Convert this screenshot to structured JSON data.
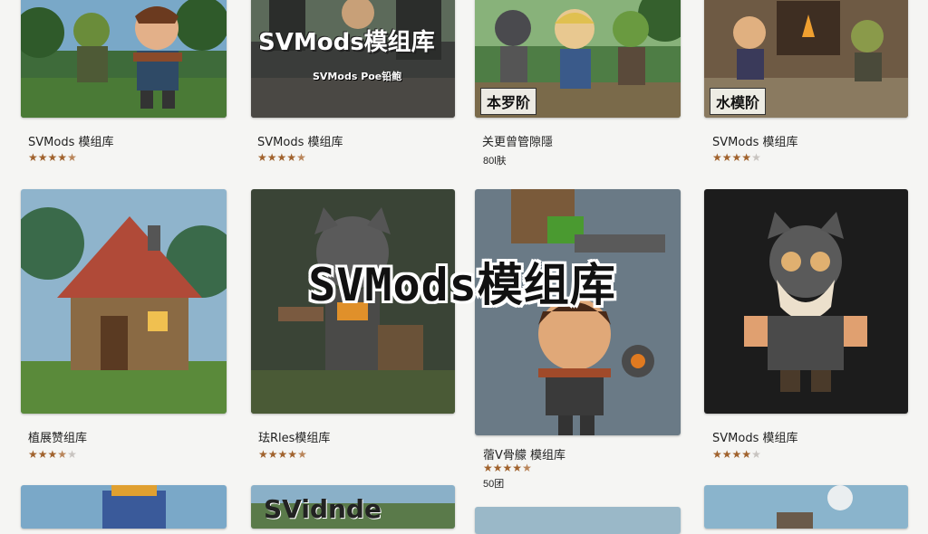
{
  "watermark": "SVMods模组库",
  "colors": {
    "background": "#f5f5f3",
    "star_filled": "#a0622d",
    "star_empty": "#c8c4c0"
  },
  "cards": [
    {
      "title": "SVMods 模组库",
      "rating": 4.5,
      "stars": "★★★★★"
    },
    {
      "title": "SVMods 模组库",
      "rating": 4.5,
      "stars": "★★★★★",
      "thumb_banner": "SVMods模组库",
      "thumb_sub": "SVMods Poe铅鲍"
    },
    {
      "title": "关更曾管隙隱",
      "meta": "80l肤",
      "thumb_tag": "本罗阶"
    },
    {
      "title": "SVMods 模组库",
      "rating": 4.0,
      "stars": "★★★★★",
      "thumb_tag": "水模阶"
    },
    {
      "title": "植展赞组库",
      "rating": 3.5,
      "stars": "★★★★★"
    },
    {
      "title": "珐Rles模组库",
      "rating": 4.5,
      "stars": "★★★★★"
    },
    {
      "title": "蓿V骨艨 模组库",
      "rating": 4.5,
      "stars": "★★★★★",
      "meta": "50团"
    },
    {
      "title": "SVMods 模组库",
      "rating": 4.0,
      "stars": "★★★★★"
    },
    {
      "thumb_banner": "SVidnde"
    }
  ]
}
